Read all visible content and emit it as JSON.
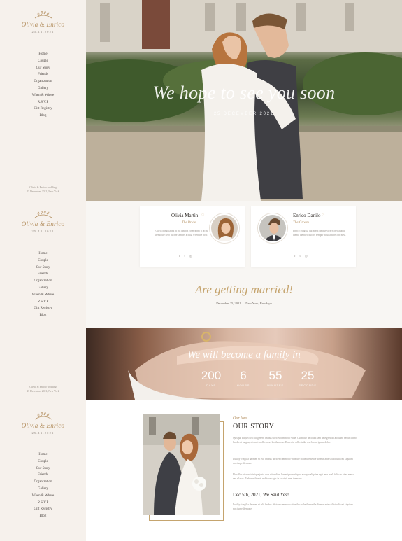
{
  "sidebar": {
    "couple_name": "Olivia & Enrico",
    "date": "25.11.2021",
    "menu": [
      "Home",
      "Couple",
      "Our Story",
      "Friends",
      "Organization",
      "Gallery",
      "When & Where",
      "R.S.V.P",
      "Gift Registry",
      "Blog"
    ],
    "footer_line1": "Olivia & Enrico wedding",
    "footer_line2": "25 December 2021, New York"
  },
  "hero": {
    "title": "We hope to see you soon",
    "date": "25 DECEMBER 2021"
  },
  "couple": {
    "bride": {
      "name": "Olivia Martin",
      "role": "The Bride",
      "desc": "Olivia fringilla dui at elit finibus viverra nec a lacus themo the nivo ducere semper actulia when the now."
    },
    "groom": {
      "name": "Enrico Danilo",
      "role": "The Groom",
      "desc": "Enrico fringilla dui at elit finibus viverra nec a lacus themo the nivo ducere semper actulia when the now."
    },
    "social_icons": [
      "facebook-icon",
      "twitter-icon",
      "instagram-icon"
    ]
  },
  "married": {
    "title": "Are getting married!",
    "subtitle": "December 25, 2021 — New York, Brooklyn"
  },
  "countdown": {
    "title": "We will become a family in",
    "items": [
      {
        "value": "200",
        "label": "DAYS"
      },
      {
        "value": "6",
        "label": "HOURS"
      },
      {
        "value": "55",
        "label": "MINUTES"
      },
      {
        "value": "25",
        "label": "SECONDS"
      }
    ]
  },
  "story": {
    "small_title": "Our love",
    "title": "OUR STORY",
    "p1": "Quisque aliquet nisl elit genere finibus ultrices commodo vitae. Curabitur tincidunt sem ante gravida aliquam, neque libero hendrerit magna, sit amet mollis lacus leo themone. Donec in sollicitudin erat lorem ipsum dolor.",
    "p2": "Luality fringilla daomen sit elit finibus ultrices commodo vitae the crahe theme the diverse ante sollicitudin mi siquipm non turpe themone.",
    "p3": "Phasellus viverra tristique justo duis vitae diam lorem ipsum aliquet a augue aliquine eget ante in alt feliscus vitae massa nec a lacus. Turbinne themis andrique sagis in suscipit nam themone.",
    "date_title": "Dec 5th, 2021, We Said Yes!",
    "p4": "Luality fringilla daomen sit elit finibus ultrices commodo vitae the crahe theme the diverse ante sollicitudin mi siquipm non turpe themone."
  },
  "colors": {
    "accent": "#c5a46e",
    "sidebar_bg": "#f6f1ec"
  }
}
